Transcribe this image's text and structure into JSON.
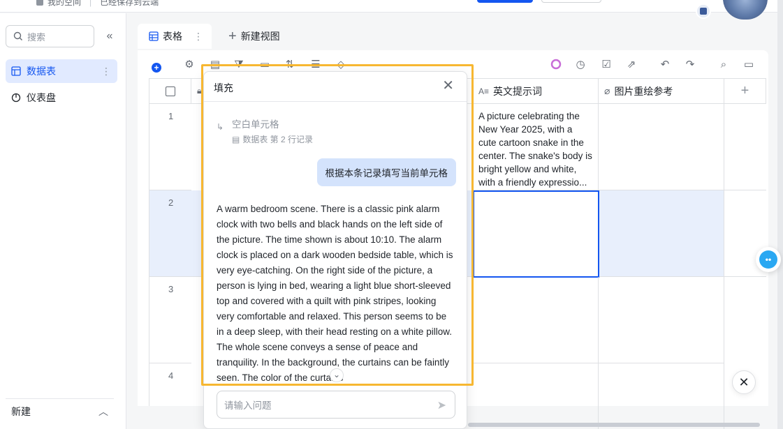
{
  "topbar": {
    "workspace": "我的空间",
    "save_status": "已经保存到云端"
  },
  "sidebar": {
    "search_placeholder": "搜索",
    "items": [
      {
        "label": "数据表",
        "active": true
      },
      {
        "label": "仪表盘",
        "active": false
      }
    ],
    "footer_label": "新建"
  },
  "view": {
    "tab_label": "表格",
    "new_view_label": "新建视图"
  },
  "grid": {
    "columns": [
      {
        "label": "英文提示词",
        "icon": "text-ai-icon"
      },
      {
        "label": "图片重绘参考",
        "icon": "attachment-icon"
      }
    ],
    "rows": [
      {
        "num": "1",
        "prompt": "A picture celebrating the New Year 2025, with a cute cartoon snake in the center. The snake's body is bright yellow and white, with a friendly expressio..."
      },
      {
        "num": "2",
        "prompt": ""
      },
      {
        "num": "3",
        "prompt": ""
      },
      {
        "num": "4",
        "prompt": ""
      }
    ]
  },
  "fill_panel": {
    "title": "填充",
    "context_title": "空白单元格",
    "context_sub": "数据表 第 2 行记录",
    "user_message": "根据本条记录填写当前单元格",
    "answer": "A warm bedroom scene. There is a classic pink alarm clock with two bells and black hands on the left side of the picture. The time shown is about 10:10. The alarm clock is placed on a dark wooden bedside table, which is very eye-catching. On the right side of the picture, a person is lying in bed, wearing a light blue short-sleeved top and covered with a quilt with pink stripes, looking very comfortable and relaxed. This person seems to be in a deep sleep, with their head resting on a white pillow. The whole scene conveys a sense of peace and tranquility. In the background, the curtains can be faintly seen. The color of the curtains",
    "input_placeholder": "请输入问题"
  },
  "colors": {
    "accent": "#1456f0",
    "highlight_border": "#f7b731",
    "row_highlight": "#e8effc",
    "bubble": "#d4e3fc"
  }
}
